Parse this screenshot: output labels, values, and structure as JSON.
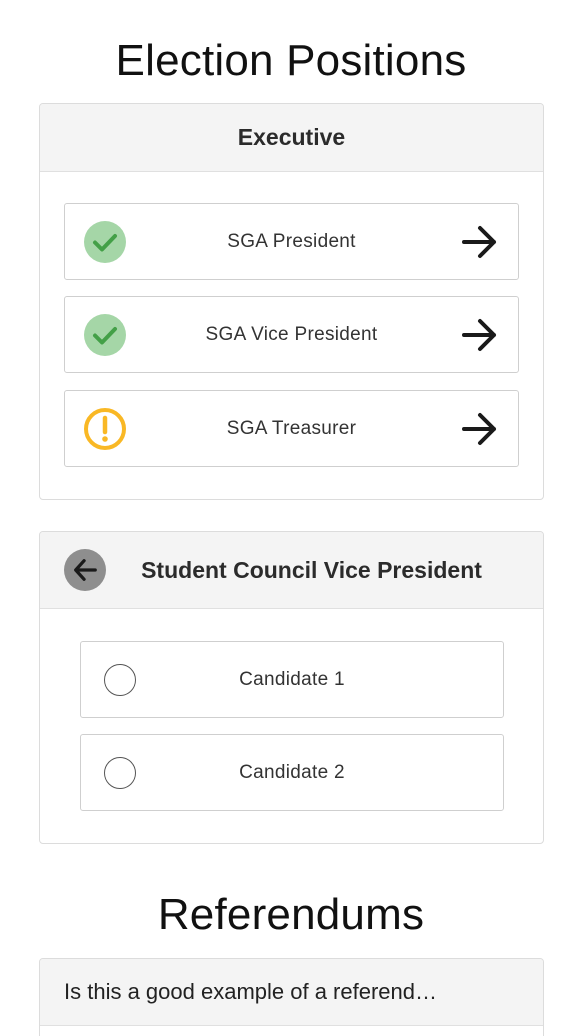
{
  "election": {
    "title": "Election Positions"
  },
  "executive": {
    "header": "Executive",
    "positions": [
      {
        "label": "SGA President",
        "status": "complete",
        "icon": "check-circle-icon"
      },
      {
        "label": "SGA Vice President",
        "status": "complete",
        "icon": "check-circle-icon"
      },
      {
        "label": "SGA Treasurer",
        "status": "warning",
        "icon": "exclamation-circle-icon"
      }
    ]
  },
  "council": {
    "header": "Student Council Vice President",
    "back_icon": "arrow-left-icon",
    "candidates": [
      {
        "label": "Candidate 1",
        "selected": false
      },
      {
        "label": "Candidate 2",
        "selected": false
      }
    ]
  },
  "referendums": {
    "title": "Referendums",
    "items": [
      {
        "label": "Is this a good example of a referend…"
      }
    ]
  },
  "colors": {
    "success_fill": "#a5d6a7",
    "success_check": "#43a047",
    "warning": "#f9b825",
    "header_bg": "#f4f4f4",
    "border": "#dcdcdc"
  }
}
